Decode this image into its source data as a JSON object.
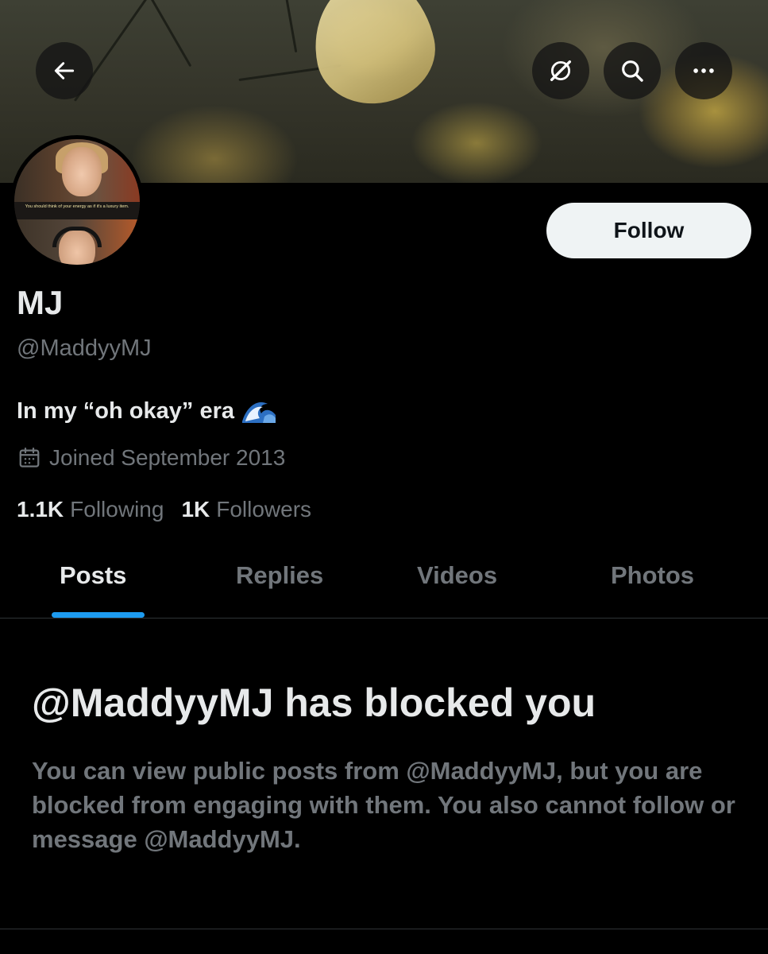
{
  "header": {
    "back_icon": "arrow-left-icon",
    "grok_icon": "grok-icon",
    "search_icon": "search-icon",
    "more_icon": "more-horizontal-icon"
  },
  "avatar": {
    "caption": "You should think of your energy as if it's a luxury item."
  },
  "profile": {
    "follow_label": "Follow",
    "name": "MJ",
    "handle": "@MaddyyMJ",
    "bio": "In my “oh okay” era",
    "bio_emoji": "wave-emoji",
    "joined": "Joined September 2013",
    "following_count": "1.1K",
    "following_label": "Following",
    "followers_count": "1K",
    "followers_label": "Followers"
  },
  "tabs": [
    {
      "label": "Posts"
    },
    {
      "label": "Replies"
    },
    {
      "label": "Videos"
    },
    {
      "label": "Photos"
    }
  ],
  "blocked": {
    "title": "@MaddyyMJ has blocked you",
    "description": "You can view public posts from @MaddyyMJ, but you are blocked from engaging with them. You also cannot follow or message @MaddyyMJ."
  },
  "colors": {
    "background": "#000000",
    "accent": "#1d9bf0",
    "secondary_text": "#71767b",
    "primary_text": "#e7e9ea",
    "follow_button": "#eff3f4"
  }
}
